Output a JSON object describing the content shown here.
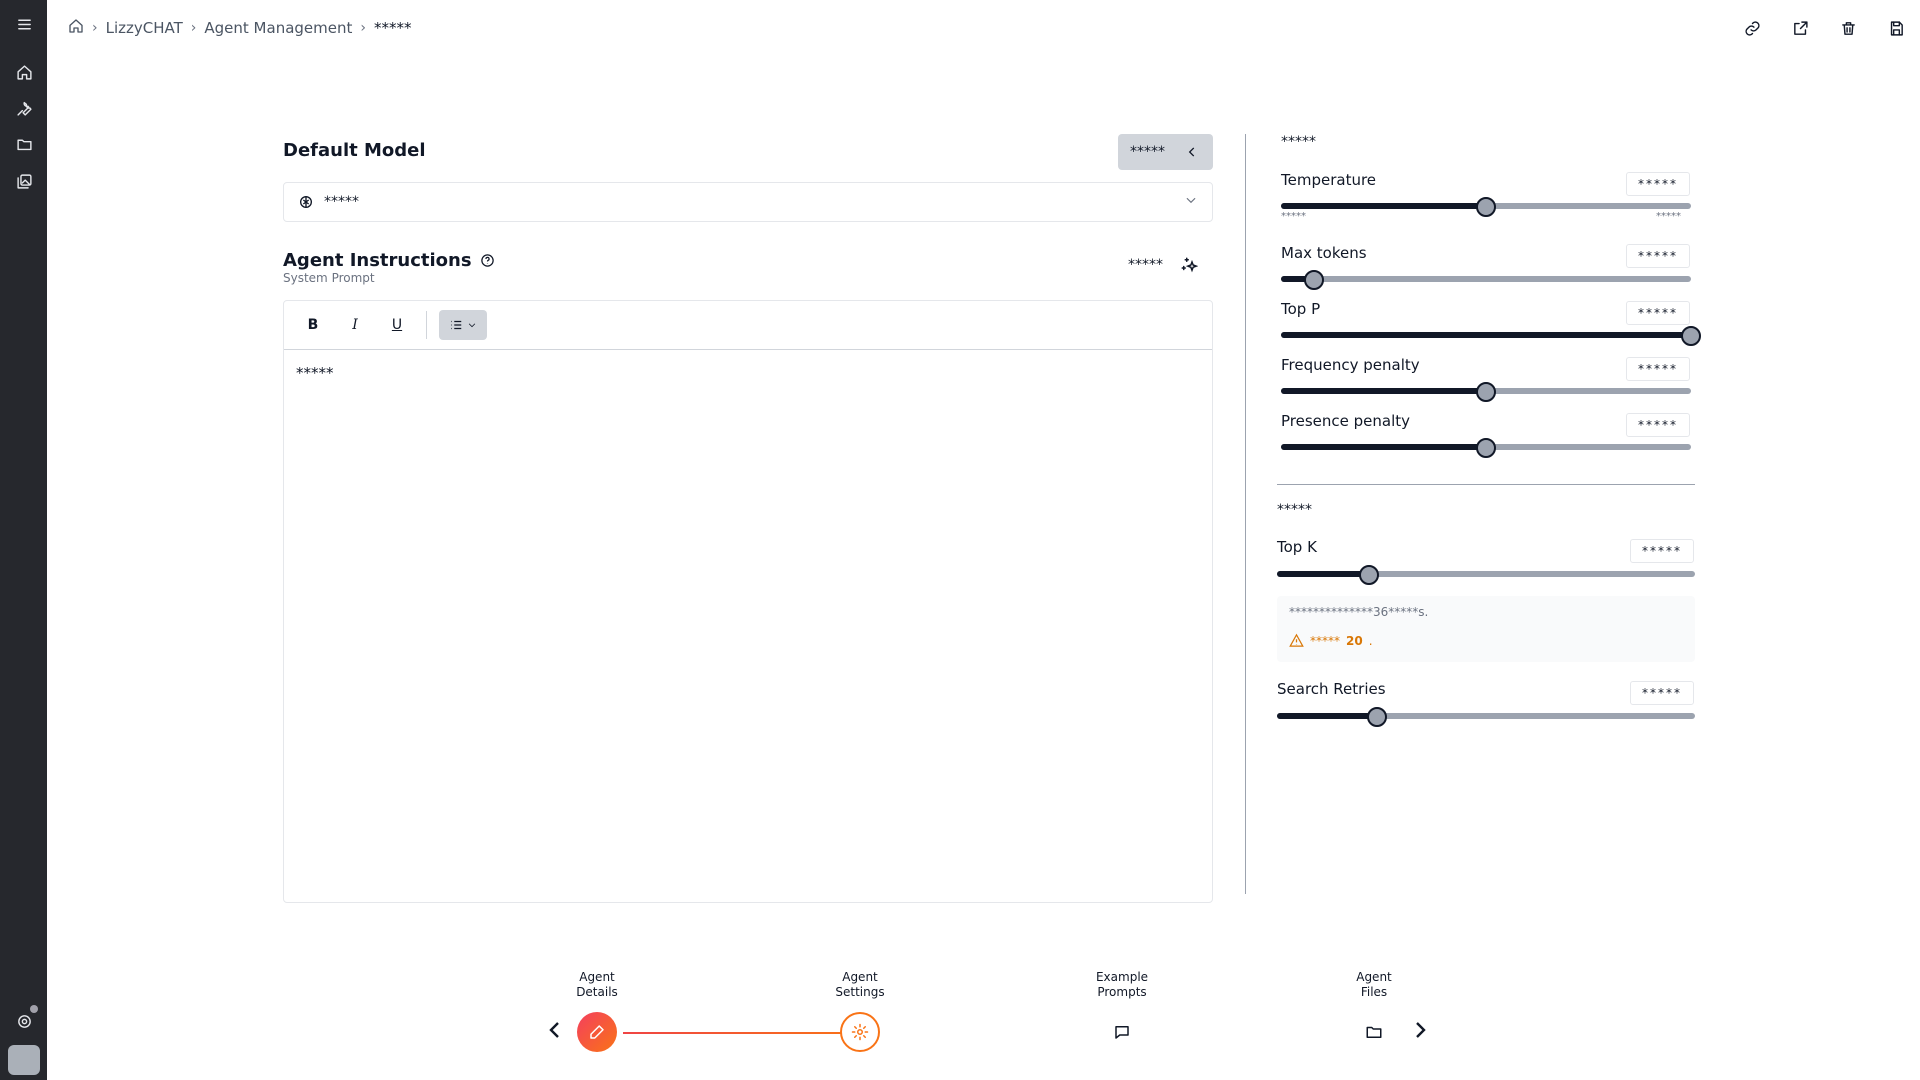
{
  "breadcrumb": {
    "items": [
      "LizzyCHAT",
      "Agent Management"
    ],
    "current": "*****"
  },
  "model_section": {
    "title": "Default Model",
    "collapse_label": "*****",
    "selected_model": "*****"
  },
  "instructions": {
    "title": "Agent Instructions",
    "subtitle": "System Prompt",
    "generate_label": "*****",
    "content": "*****",
    "toolbar": {
      "bold": "B",
      "italic": "I",
      "underline": "U"
    }
  },
  "params": {
    "section_label": "*****",
    "temperature": {
      "label": "Temperature",
      "value": "*****",
      "fraction": 0.5,
      "min_label": "*****",
      "max_label": "*****"
    },
    "max_tokens": {
      "label": "Max tokens",
      "value": "*****",
      "fraction": 0.08
    },
    "top_p": {
      "label": "Top P",
      "value": "*****",
      "fraction": 1.0
    },
    "frequency_penalty": {
      "label": "Frequency penalty",
      "value": "*****",
      "fraction": 0.5
    },
    "presence_penalty": {
      "label": "Presence penalty",
      "value": "*****",
      "fraction": 0.5
    }
  },
  "retrieval": {
    "section_label": "*****",
    "top_k": {
      "label": "Top K",
      "value": "*****",
      "fraction": 0.22
    },
    "info_text": "**************36*****s.",
    "warning_prefix": "*****",
    "warning_number": "20",
    "warning_suffix": ".",
    "search_retries": {
      "label": "Search Retries",
      "value": "*****",
      "fraction": 0.24
    }
  },
  "stepper": {
    "steps": [
      {
        "line1": "Agent",
        "line2": "Details"
      },
      {
        "line1": "Agent",
        "line2": "Settings"
      },
      {
        "line1": "Example",
        "line2": "Prompts"
      },
      {
        "line1": "Agent",
        "line2": "Files"
      }
    ]
  },
  "colors": {
    "sidebar": "#26282d",
    "accent_start": "#ef4444",
    "accent_end": "#f97316",
    "warning": "#d97706"
  }
}
